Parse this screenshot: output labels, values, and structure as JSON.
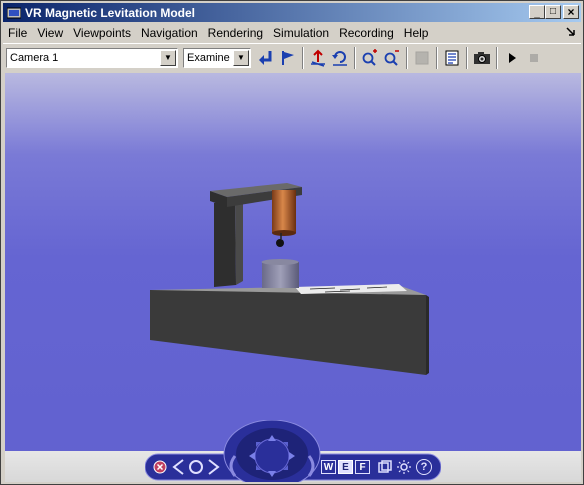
{
  "window": {
    "title": "VR Magnetic Levitation Model",
    "minimize_glyph": "_",
    "maximize_glyph": "□",
    "close_glyph": "×"
  },
  "menu": {
    "items": [
      "File",
      "View",
      "Viewpoints",
      "Navigation",
      "Rendering",
      "Simulation",
      "Recording",
      "Help"
    ],
    "corner_icon": "restore-arrow-icon"
  },
  "toolbar": {
    "viewpoint_select": {
      "value": "Camera 1"
    },
    "navigation_select": {
      "value": "Examine"
    },
    "buttons": [
      "return-to-viewpoint-icon",
      "create-viewpoint-flag-icon",
      "straighten-up-icon",
      "undo-move-icon",
      "zoom-in-icon",
      "zoom-out-icon",
      "headlight-toggle-icon",
      "block-diagram-icon",
      "capture-frame-icon",
      "start-simulation-icon",
      "stop-simulation-icon"
    ]
  },
  "nav_panel": {
    "buttons": {
      "hide": "close-panel-icon",
      "prev_viewpoint": "previous-viewpoint-icon",
      "home_viewpoint": "home-viewpoint-icon",
      "next_viewpoint": "next-viewpoint-icon",
      "walk": "W",
      "examine": "E",
      "fly": "F",
      "viewpoint_list": "viewpoint-list-icon",
      "headlight": "headlight-icon",
      "help": "?"
    }
  },
  "colors": {
    "titlebar_start": "#0a246a",
    "titlebar_end": "#a6caf0",
    "viewport_sky": "#6565d2",
    "panel_blue": "#2a2f9a"
  }
}
